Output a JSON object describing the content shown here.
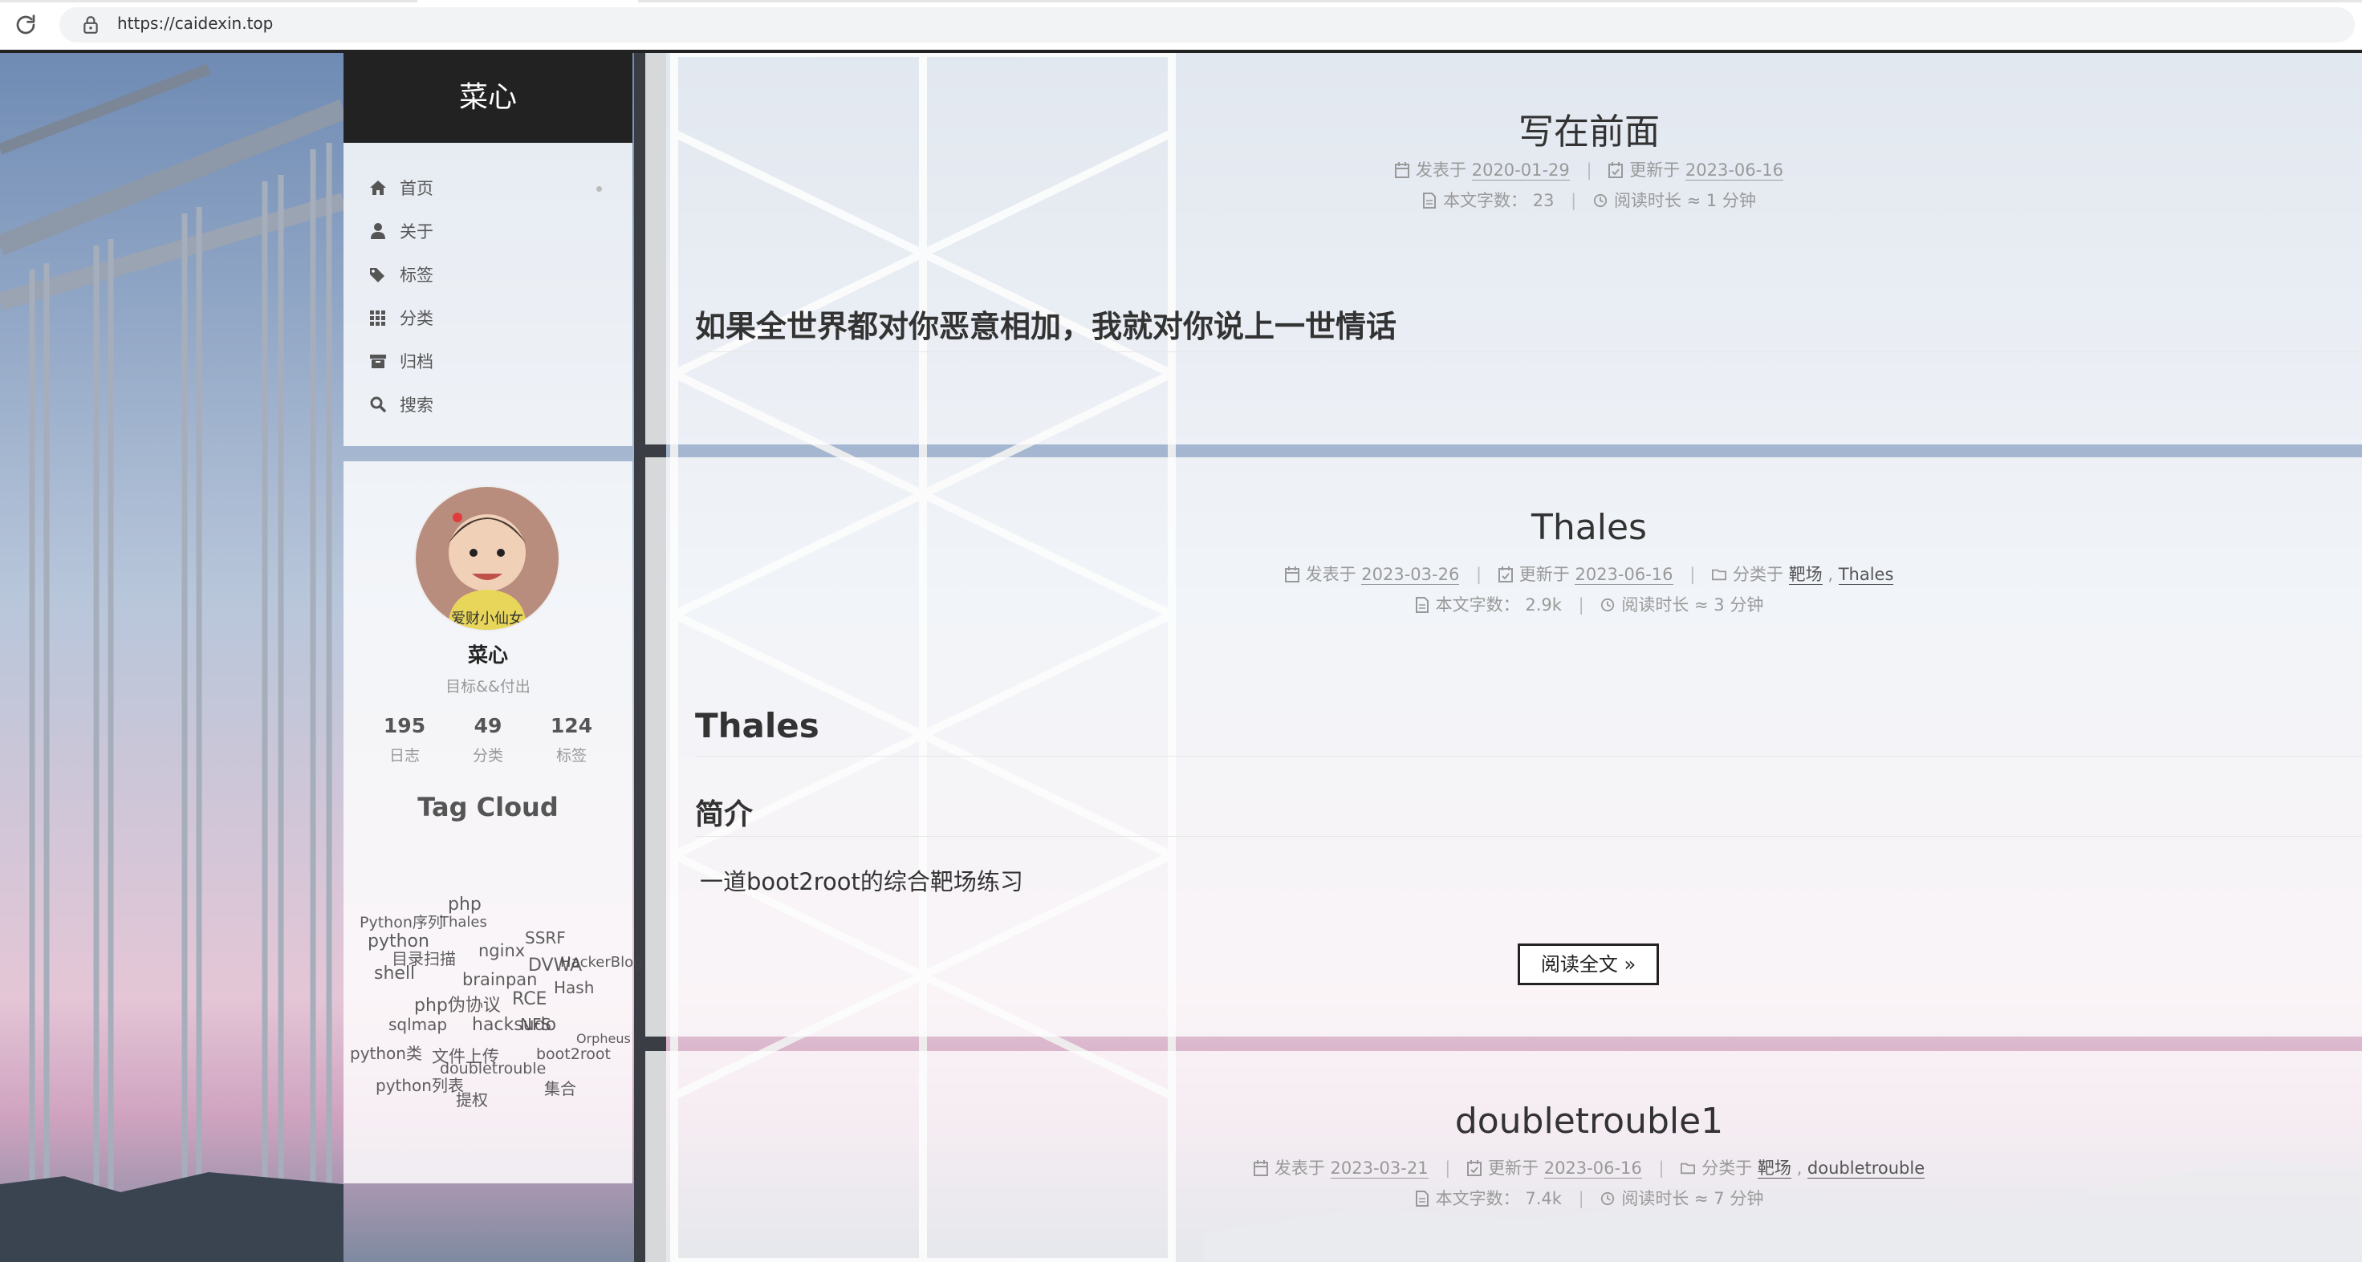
{
  "browser": {
    "url": "https://caidexin.top"
  },
  "sidebar": {
    "site_title": "菜心",
    "nav": [
      {
        "label": "首页",
        "icon": "home-icon"
      },
      {
        "label": "关于",
        "icon": "user-icon"
      },
      {
        "label": "标签",
        "icon": "tags-icon"
      },
      {
        "label": "分类",
        "icon": "th-icon"
      },
      {
        "label": "归档",
        "icon": "archive-icon"
      },
      {
        "label": "搜索",
        "icon": "search-icon"
      }
    ],
    "author": {
      "name": "菜心",
      "description": "目标&&付出",
      "avatar_caption": "爱财小仙女"
    },
    "stats": [
      {
        "value": "195",
        "label": "日志"
      },
      {
        "value": "49",
        "label": "分类"
      },
      {
        "value": "124",
        "label": "标签"
      }
    ],
    "tag_cloud_title": "Tag Cloud",
    "tags": [
      "php",
      "python",
      "nginx",
      "SSRF",
      "DVWA",
      "shell",
      "Hash",
      "brainpan",
      "HackerBlog",
      "php伪协议",
      "RCE",
      "hacksudo",
      "python列表",
      "python类",
      "文件上传",
      "集合",
      "sqlmap",
      "Thales",
      "boot2root",
      "doubletrouble",
      "NFS",
      "Python序列",
      "提权",
      "目录扫描",
      "Orpheus"
    ]
  },
  "posts": [
    {
      "title": "写在前面",
      "posted_label": "发表于",
      "posted": "2020-01-29",
      "updated_label": "更新于",
      "updated": "2023-06-16",
      "wordcount_label": "本文字数：",
      "wordcount": "23",
      "readtime": "阅读时长 ≈ 1 分钟",
      "heading": "如果全世界都对你恶意相加，我就对你说上一世情话"
    },
    {
      "title": "Thales",
      "posted_label": "发表于",
      "posted": "2023-03-26",
      "updated_label": "更新于",
      "updated": "2023-06-16",
      "category_label": "分类于",
      "categories": [
        "靶场",
        "Thales"
      ],
      "wordcount_label": "本文字数：",
      "wordcount": "2.9k",
      "readtime": "阅读时长 ≈ 3 分钟",
      "h1": "Thales",
      "h2": "简介",
      "paragraph": "一道boot2root的综合靶场练习",
      "read_more": "阅读全文 »"
    },
    {
      "title": "doubletrouble1",
      "posted_label": "发表于",
      "posted": "2023-03-21",
      "updated_label": "更新于",
      "updated": "2023-06-16",
      "category_label": "分类于",
      "categories": [
        "靶场",
        "doubletrouble"
      ],
      "wordcount_label": "本文字数：",
      "wordcount": "7.4k",
      "readtime": "阅读时长 ≈ 7 分钟"
    }
  ]
}
